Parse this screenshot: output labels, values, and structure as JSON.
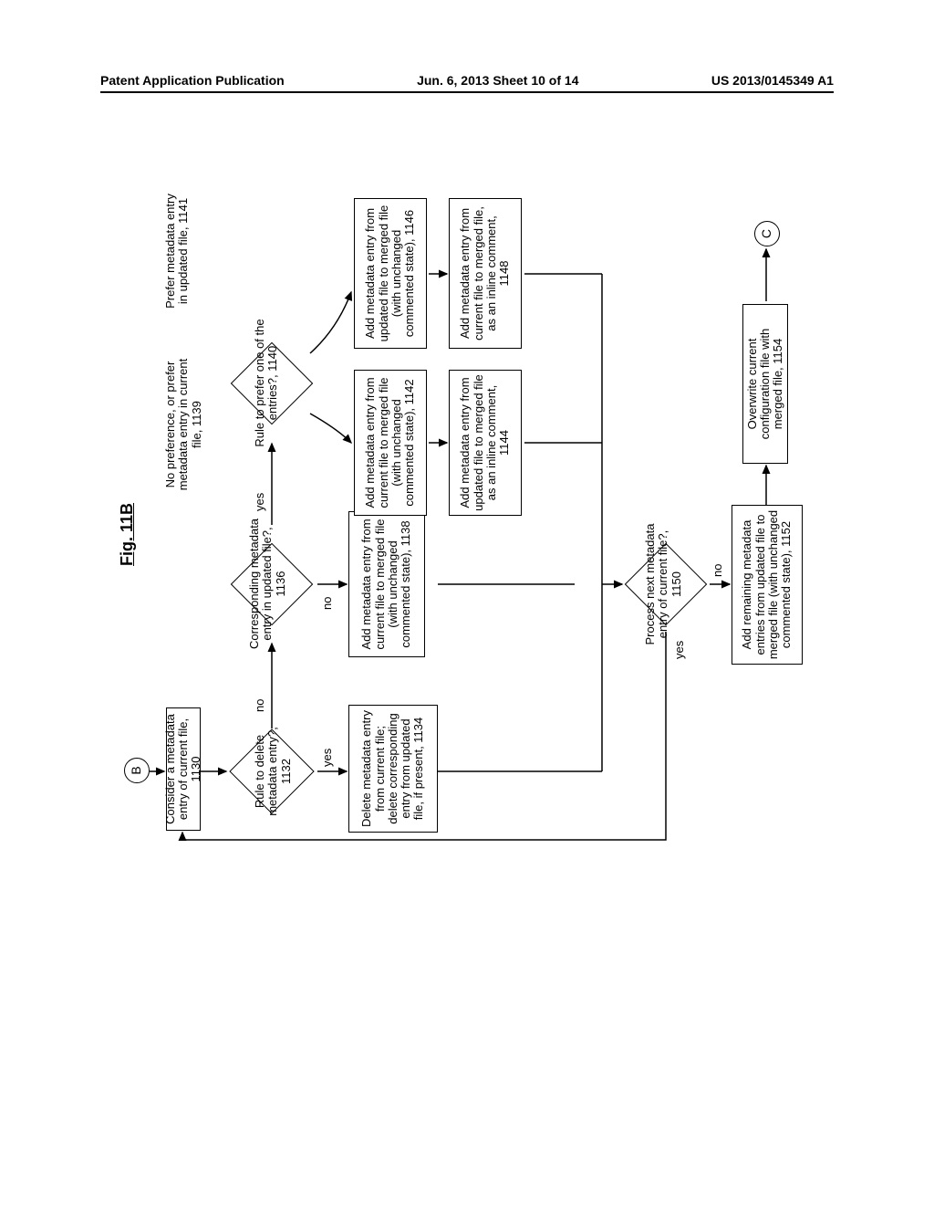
{
  "header": {
    "left": "Patent Application Publication",
    "center": "Jun. 6, 2013  Sheet 10 of 14",
    "right": "US 2013/0145349 A1"
  },
  "figure": {
    "title": "Fig. 11B"
  },
  "connectors": {
    "b": "B",
    "c": "C"
  },
  "nodes": {
    "n1130": "Consider a metadata entry of current file, 1130",
    "n1132": "Rule to delete metadata entry?, 1132",
    "n1134": "Delete metadata entry from current file; delete corresponding entry from updated file, if present, 1134",
    "n1136": "Corresponding metadata entry in updated file?, 1136",
    "n1138": "Add metadata entry from current file to merged file (with unchanged commented state), 1138",
    "n1140": "Rule to prefer one of the entries?, 1140",
    "n1139": "No preference, or prefer metadata entry in current file, 1139",
    "n1141": "Prefer metadata entry in updated file, 1141",
    "n1142": "Add metadata entry from current file to merged file (with unchanged commented state), 1142",
    "n1144": "Add metadata entry from updated file to merged file as an inline comment, 1144",
    "n1146": "Add metadata entry from updated file to merged file (with unchanged commented state), 1146",
    "n1148": "Add metadata entry from current file to merged file, as an inline comment, 1148",
    "n1150": "Process next metadata entry of current file?, 1150",
    "n1152": "Add remaining metadata entries from updated file to merged file (with unchanged commented state), 1152",
    "n1154": "Overwrite current configuration file with merged file, 1154"
  },
  "labels": {
    "yes": "yes",
    "no": "no"
  },
  "chart_data": {
    "type": "flowchart",
    "title": "Fig. 11B",
    "connectors": [
      "B",
      "C"
    ],
    "nodes": [
      {
        "id": 1130,
        "type": "process",
        "text": "Consider a metadata entry of current file"
      },
      {
        "id": 1132,
        "type": "decision",
        "text": "Rule to delete metadata entry?"
      },
      {
        "id": 1134,
        "type": "process",
        "text": "Delete metadata entry from current file; delete corresponding entry from updated file, if present"
      },
      {
        "id": 1136,
        "type": "decision",
        "text": "Corresponding metadata entry in updated file?"
      },
      {
        "id": 1138,
        "type": "process",
        "text": "Add metadata entry from current file to merged file (with unchanged commented state)"
      },
      {
        "id": 1139,
        "type": "label",
        "text": "No preference, or prefer metadata entry in current file"
      },
      {
        "id": 1140,
        "type": "decision",
        "text": "Rule to prefer one of the entries?"
      },
      {
        "id": 1141,
        "type": "label",
        "text": "Prefer metadata entry in updated file"
      },
      {
        "id": 1142,
        "type": "process",
        "text": "Add metadata entry from current file to merged file (with unchanged commented state)"
      },
      {
        "id": 1144,
        "type": "process",
        "text": "Add metadata entry from updated file to merged file as an inline comment"
      },
      {
        "id": 1146,
        "type": "process",
        "text": "Add metadata entry from updated file to merged file (with unchanged commented state)"
      },
      {
        "id": 1148,
        "type": "process",
        "text": "Add metadata entry from current file to merged file, as an inline comment"
      },
      {
        "id": 1150,
        "type": "decision",
        "text": "Process next metadata entry of current file?"
      },
      {
        "id": 1152,
        "type": "process",
        "text": "Add remaining metadata entries from updated file to merged file (with unchanged commented state)"
      },
      {
        "id": 1154,
        "type": "process",
        "text": "Overwrite current configuration file with merged file"
      }
    ],
    "edges": [
      {
        "from": "B",
        "to": 1130
      },
      {
        "from": 1130,
        "to": 1132
      },
      {
        "from": 1132,
        "to": 1134,
        "label": "yes"
      },
      {
        "from": 1132,
        "to": 1136,
        "label": "no"
      },
      {
        "from": 1136,
        "to": 1138,
        "label": "no"
      },
      {
        "from": 1136,
        "to": 1140,
        "label": "yes"
      },
      {
        "from": 1140,
        "to": 1142,
        "via": 1139
      },
      {
        "from": 1140,
        "to": 1146,
        "via": 1141
      },
      {
        "from": 1142,
        "to": 1144
      },
      {
        "from": 1146,
        "to": 1148
      },
      {
        "from": 1134,
        "to": 1150
      },
      {
        "from": 1138,
        "to": 1150
      },
      {
        "from": 1144,
        "to": 1150
      },
      {
        "from": 1148,
        "to": 1150
      },
      {
        "from": 1150,
        "to": 1130,
        "label": "yes"
      },
      {
        "from": 1150,
        "to": 1152,
        "label": "no"
      },
      {
        "from": 1152,
        "to": 1154
      },
      {
        "from": 1154,
        "to": "C"
      }
    ]
  }
}
